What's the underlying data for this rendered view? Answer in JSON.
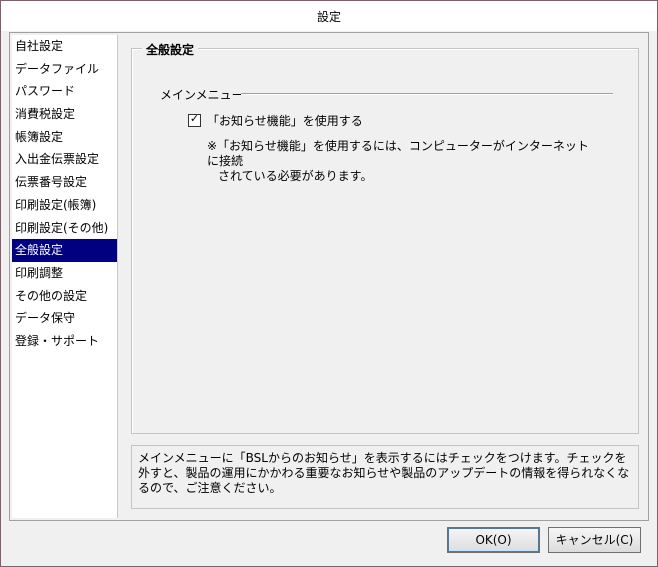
{
  "window": {
    "title": "設定"
  },
  "nav": {
    "items": [
      {
        "label": "自社設定"
      },
      {
        "label": "データファイル"
      },
      {
        "label": "パスワード"
      },
      {
        "label": "消費税設定"
      },
      {
        "label": "帳簿設定"
      },
      {
        "label": "入出金伝票設定"
      },
      {
        "label": "伝票番号設定"
      },
      {
        "label": "印刷設定(帳簿)"
      },
      {
        "label": "印刷設定(その他)"
      },
      {
        "label": "全般設定",
        "selected": true
      },
      {
        "label": "印刷調整"
      },
      {
        "label": "その他の設定"
      },
      {
        "label": "データ保守"
      },
      {
        "label": "登録・サポート"
      }
    ],
    "selected_color": "#000080"
  },
  "main": {
    "group_title": "全般設定",
    "section_label": "メインメニュー",
    "checkbox": {
      "label": "「お知らせ機能」を使用する",
      "checked": true
    },
    "note_line1": "※「お知らせ機能」を使用するには、コンピューターがインターネットに接続",
    "note_line2": "されている必要があります。"
  },
  "info": {
    "text": "メインメニューに「BSLからのお知らせ」を表示するにはチェックをつけます。チェックを外すと、製品の運用にかかわる重要なお知らせや製品のアップデートの情報を得られなくなるので、ご注意ください。"
  },
  "buttons": {
    "ok": "OK(O)",
    "cancel": "キャンセル(C)"
  }
}
